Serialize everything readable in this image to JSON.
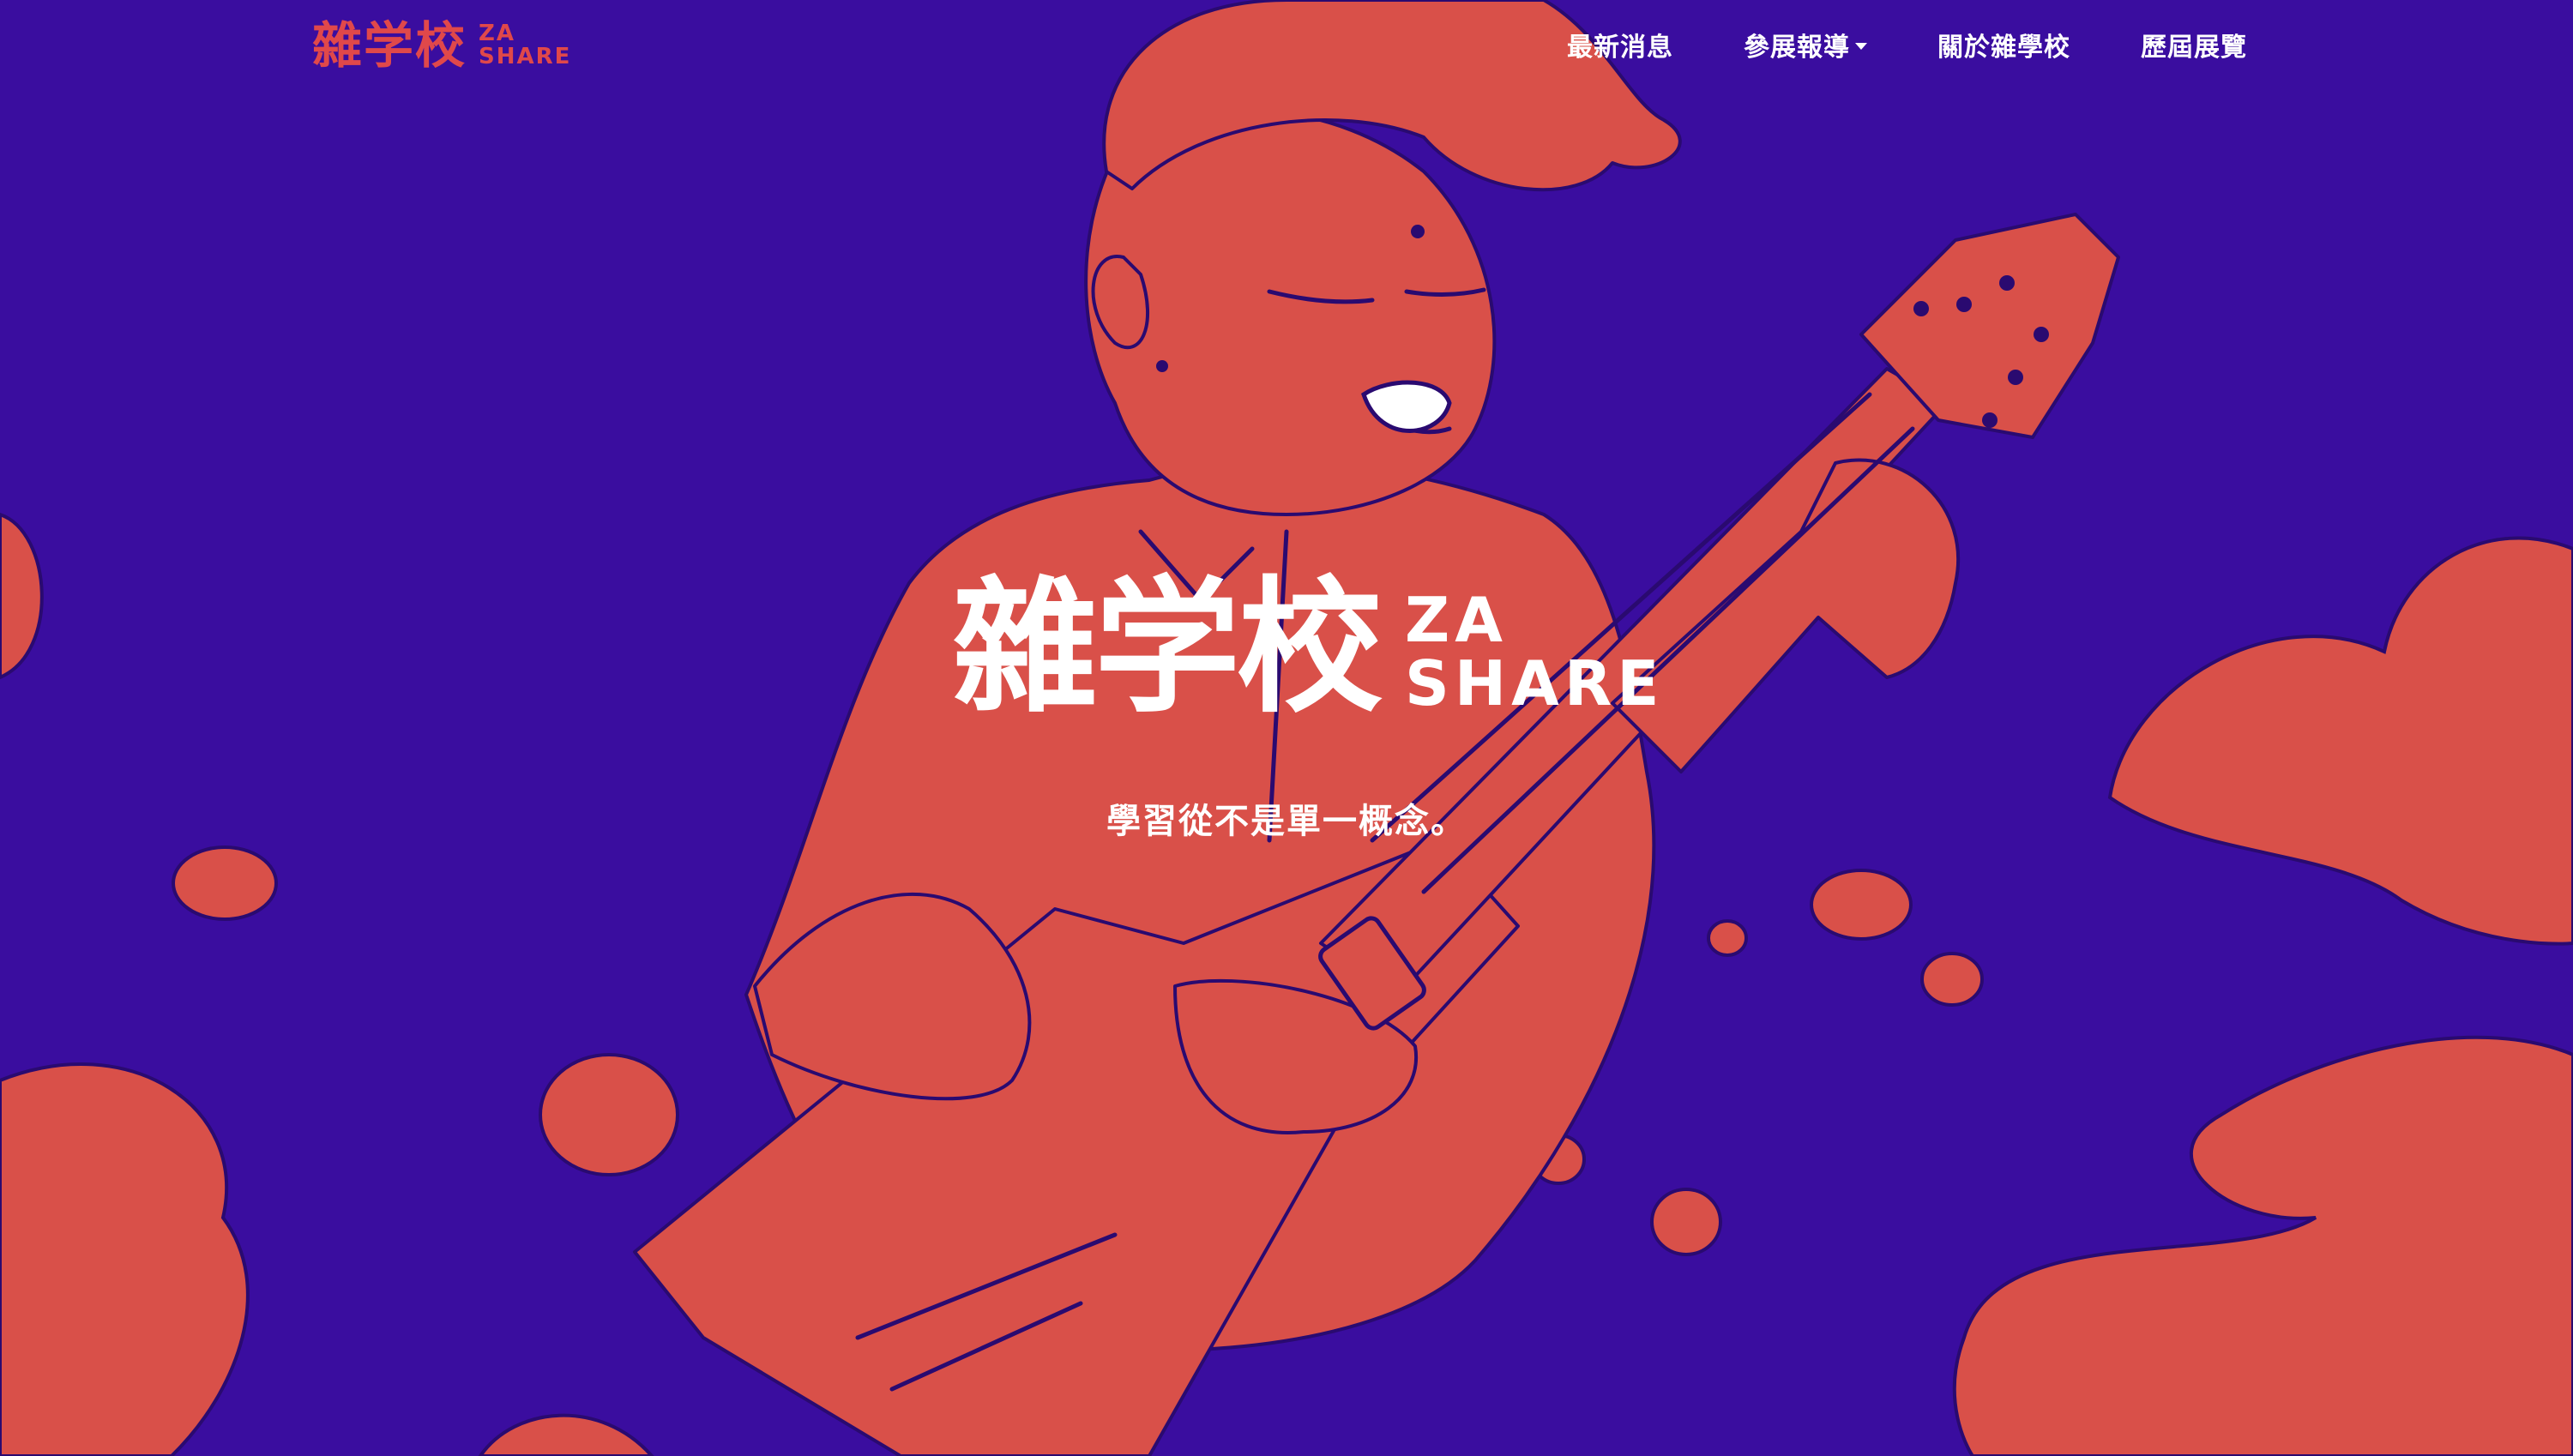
{
  "header": {
    "brand_cjk": "雜学校",
    "brand_latin_top": "ZA",
    "brand_latin_bottom": "SHARE"
  },
  "nav": {
    "items": [
      {
        "label": "最新消息"
      },
      {
        "label": "參展報導",
        "has_dropdown": true
      },
      {
        "label": "關於雜學校"
      },
      {
        "label": "歷屆展覽"
      }
    ]
  },
  "hero": {
    "logo_cjk": "雜学校",
    "logo_latin_top": "ZA",
    "logo_latin_bottom": "SHARE",
    "tagline": "學習從不是單一概念。",
    "illustration": "boy-playing-guitar-illustration"
  },
  "colors": {
    "background": "#3a0d9f",
    "accent": "#e0484a",
    "illustration_fill": "#d95049",
    "text": "#ffffff"
  }
}
